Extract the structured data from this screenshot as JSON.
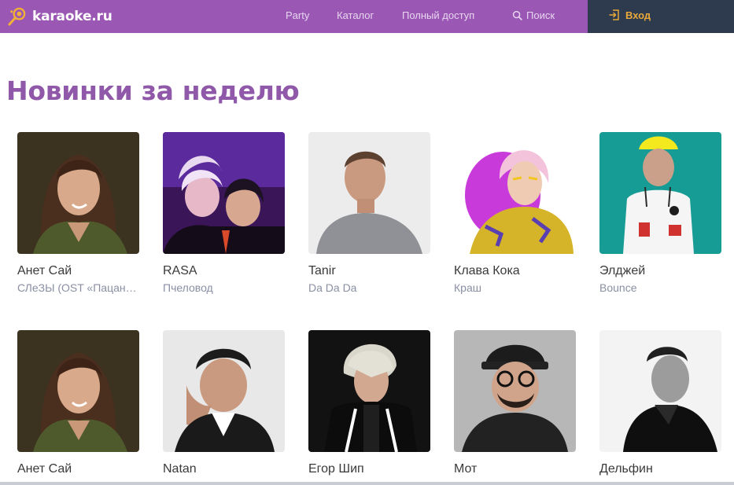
{
  "header": {
    "logo_text": "karaoke.ru",
    "nav": {
      "party": "Party",
      "catalog": "Каталог",
      "full_access": "Полный доступ",
      "search": "Поиск"
    },
    "login": "Вход"
  },
  "colors": {
    "header_purple": "#9a58b4",
    "login_bg": "#2e3a4d",
    "login_accent": "#e9a83a",
    "title_purple": "#8f58a8",
    "song_gray": "#8a8fa3"
  },
  "section": {
    "title": "Новинки за неделю"
  },
  "rows": [
    [
      {
        "artist": "Анет Сай",
        "song": "СЛеЗЫ (OST «Пацанки»)"
      },
      {
        "artist": "RASA",
        "song": "Пчеловод"
      },
      {
        "artist": "Tanir",
        "song": "Da Da Da"
      },
      {
        "artist": "Клава Кока",
        "song": "Краш"
      },
      {
        "artist": "Элджей",
        "song": "Bounce"
      }
    ],
    [
      {
        "artist": "Анет Сай",
        "song": ""
      },
      {
        "artist": "Natan",
        "song": ""
      },
      {
        "artist": "Егор Шип",
        "song": ""
      },
      {
        "artist": "Мот",
        "song": ""
      },
      {
        "artist": "Дельфин",
        "song": ""
      }
    ]
  ]
}
